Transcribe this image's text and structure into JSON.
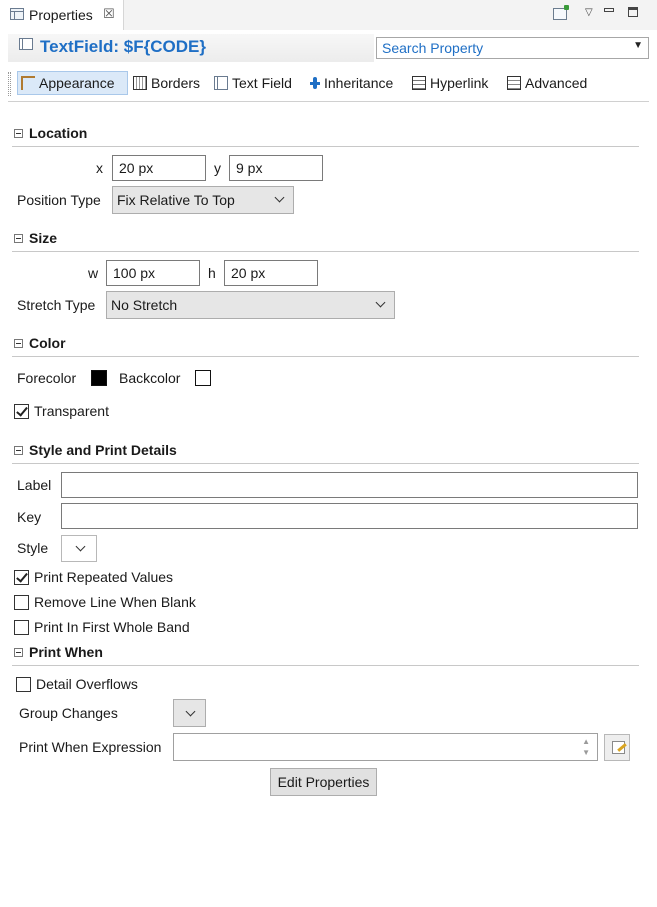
{
  "view": {
    "title": "Properties",
    "close_glyph": "☒"
  },
  "header": {
    "title": "TextField: $F{CODE}",
    "search_placeholder": "Search Property"
  },
  "tabs": [
    {
      "label": "Appearance",
      "icon": "appearance-icon",
      "active": true
    },
    {
      "label": "Borders",
      "icon": "borders-icon"
    },
    {
      "label": "Text Field",
      "icon": "text-field-icon"
    },
    {
      "label": "Inheritance",
      "icon": "inheritance-icon"
    },
    {
      "label": "Hyperlink",
      "icon": "hyperlink-icon"
    },
    {
      "label": "Advanced",
      "icon": "advanced-icon"
    }
  ],
  "location": {
    "title": "Location",
    "x_label": "x",
    "x_value": "20 px",
    "y_label": "y",
    "y_value": "9 px",
    "position_type_label": "Position Type",
    "position_type_value": "Fix Relative To Top"
  },
  "size": {
    "title": "Size",
    "w_label": "w",
    "w_value": "100 px",
    "h_label": "h",
    "h_value": "20 px",
    "stretch_type_label": "Stretch Type",
    "stretch_type_value": "No Stretch"
  },
  "color": {
    "title": "Color",
    "forecolor_label": "Forecolor",
    "forecolor": "#000000",
    "backcolor_label": "Backcolor",
    "backcolor": "#ffffff",
    "transparent_label": "Transparent",
    "transparent_checked": true
  },
  "style_print": {
    "title": "Style and Print Details",
    "label_label": "Label",
    "label_value": "",
    "key_label": "Key",
    "key_value": "",
    "style_label": "Style",
    "print_repeated_label": "Print Repeated Values",
    "print_repeated_checked": true,
    "remove_line_label": "Remove Line When Blank",
    "remove_line_checked": false,
    "print_first_band_label": "Print In First Whole Band",
    "print_first_band_checked": false
  },
  "print_when": {
    "title": "Print When",
    "detail_overflows_label": "Detail Overflows",
    "detail_overflows_checked": false,
    "group_changes_label": "Group Changes",
    "expression_label": "Print When Expression",
    "expression_value": "",
    "edit_properties_label": "Edit Properties"
  }
}
